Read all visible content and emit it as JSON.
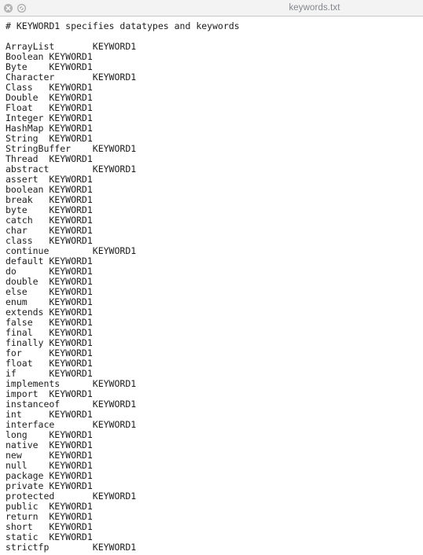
{
  "window": {
    "title": "keywords.txt",
    "header_bg": "#f3f3f3",
    "header_border": "#c8c8c8",
    "title_color": "#83868c",
    "body_bg": "#ffffff",
    "text_color": "#1d1d1d"
  },
  "titlebar": {
    "close_button_label": "",
    "block_button_label": "",
    "icons": [
      "close-circle-icon",
      "block-circle-icon"
    ],
    "icon_color": "#b4b4b4"
  },
  "document": {
    "filename": "keywords.txt",
    "comment": "# KEYWORD1 specifies datatypes and keywords",
    "blank_line": "",
    "token_label": "KEYWORD1",
    "tab_width": 8,
    "entries": [
      {
        "keyword": "ArrayList",
        "value": "KEYWORD1"
      },
      {
        "keyword": "Boolean",
        "value": "KEYWORD1"
      },
      {
        "keyword": "Byte",
        "value": "KEYWORD1"
      },
      {
        "keyword": "Character",
        "value": "KEYWORD1"
      },
      {
        "keyword": "Class",
        "value": "KEYWORD1"
      },
      {
        "keyword": "Double",
        "value": "KEYWORD1"
      },
      {
        "keyword": "Float",
        "value": "KEYWORD1"
      },
      {
        "keyword": "Integer",
        "value": "KEYWORD1"
      },
      {
        "keyword": "HashMap",
        "value": "KEYWORD1"
      },
      {
        "keyword": "String",
        "value": "KEYWORD1"
      },
      {
        "keyword": "StringBuffer",
        "value": "KEYWORD1"
      },
      {
        "keyword": "Thread",
        "value": "KEYWORD1"
      },
      {
        "keyword": "abstract",
        "value": "KEYWORD1"
      },
      {
        "keyword": "assert",
        "value": "KEYWORD1"
      },
      {
        "keyword": "boolean",
        "value": "KEYWORD1"
      },
      {
        "keyword": "break",
        "value": "KEYWORD1"
      },
      {
        "keyword": "byte",
        "value": "KEYWORD1"
      },
      {
        "keyword": "catch",
        "value": "KEYWORD1"
      },
      {
        "keyword": "char",
        "value": "KEYWORD1"
      },
      {
        "keyword": "class",
        "value": "KEYWORD1"
      },
      {
        "keyword": "continue",
        "value": "KEYWORD1"
      },
      {
        "keyword": "default",
        "value": "KEYWORD1"
      },
      {
        "keyword": "do",
        "value": "KEYWORD1"
      },
      {
        "keyword": "double",
        "value": "KEYWORD1"
      },
      {
        "keyword": "else",
        "value": "KEYWORD1"
      },
      {
        "keyword": "enum",
        "value": "KEYWORD1"
      },
      {
        "keyword": "extends",
        "value": "KEYWORD1"
      },
      {
        "keyword": "false",
        "value": "KEYWORD1"
      },
      {
        "keyword": "final",
        "value": "KEYWORD1"
      },
      {
        "keyword": "finally",
        "value": "KEYWORD1"
      },
      {
        "keyword": "for",
        "value": "KEYWORD1"
      },
      {
        "keyword": "float",
        "value": "KEYWORD1"
      },
      {
        "keyword": "if",
        "value": "KEYWORD1"
      },
      {
        "keyword": "implements",
        "value": "KEYWORD1"
      },
      {
        "keyword": "import",
        "value": "KEYWORD1"
      },
      {
        "keyword": "instanceof",
        "value": "KEYWORD1"
      },
      {
        "keyword": "int",
        "value": "KEYWORD1"
      },
      {
        "keyword": "interface",
        "value": "KEYWORD1"
      },
      {
        "keyword": "long",
        "value": "KEYWORD1"
      },
      {
        "keyword": "native",
        "value": "KEYWORD1"
      },
      {
        "keyword": "new",
        "value": "KEYWORD1"
      },
      {
        "keyword": "null",
        "value": "KEYWORD1"
      },
      {
        "keyword": "package",
        "value": "KEYWORD1"
      },
      {
        "keyword": "private",
        "value": "KEYWORD1"
      },
      {
        "keyword": "protected",
        "value": "KEYWORD1"
      },
      {
        "keyword": "public",
        "value": "KEYWORD1"
      },
      {
        "keyword": "return",
        "value": "KEYWORD1"
      },
      {
        "keyword": "short",
        "value": "KEYWORD1"
      },
      {
        "keyword": "static",
        "value": "KEYWORD1"
      },
      {
        "keyword": "strictfp",
        "value": "KEYWORD1"
      }
    ]
  }
}
